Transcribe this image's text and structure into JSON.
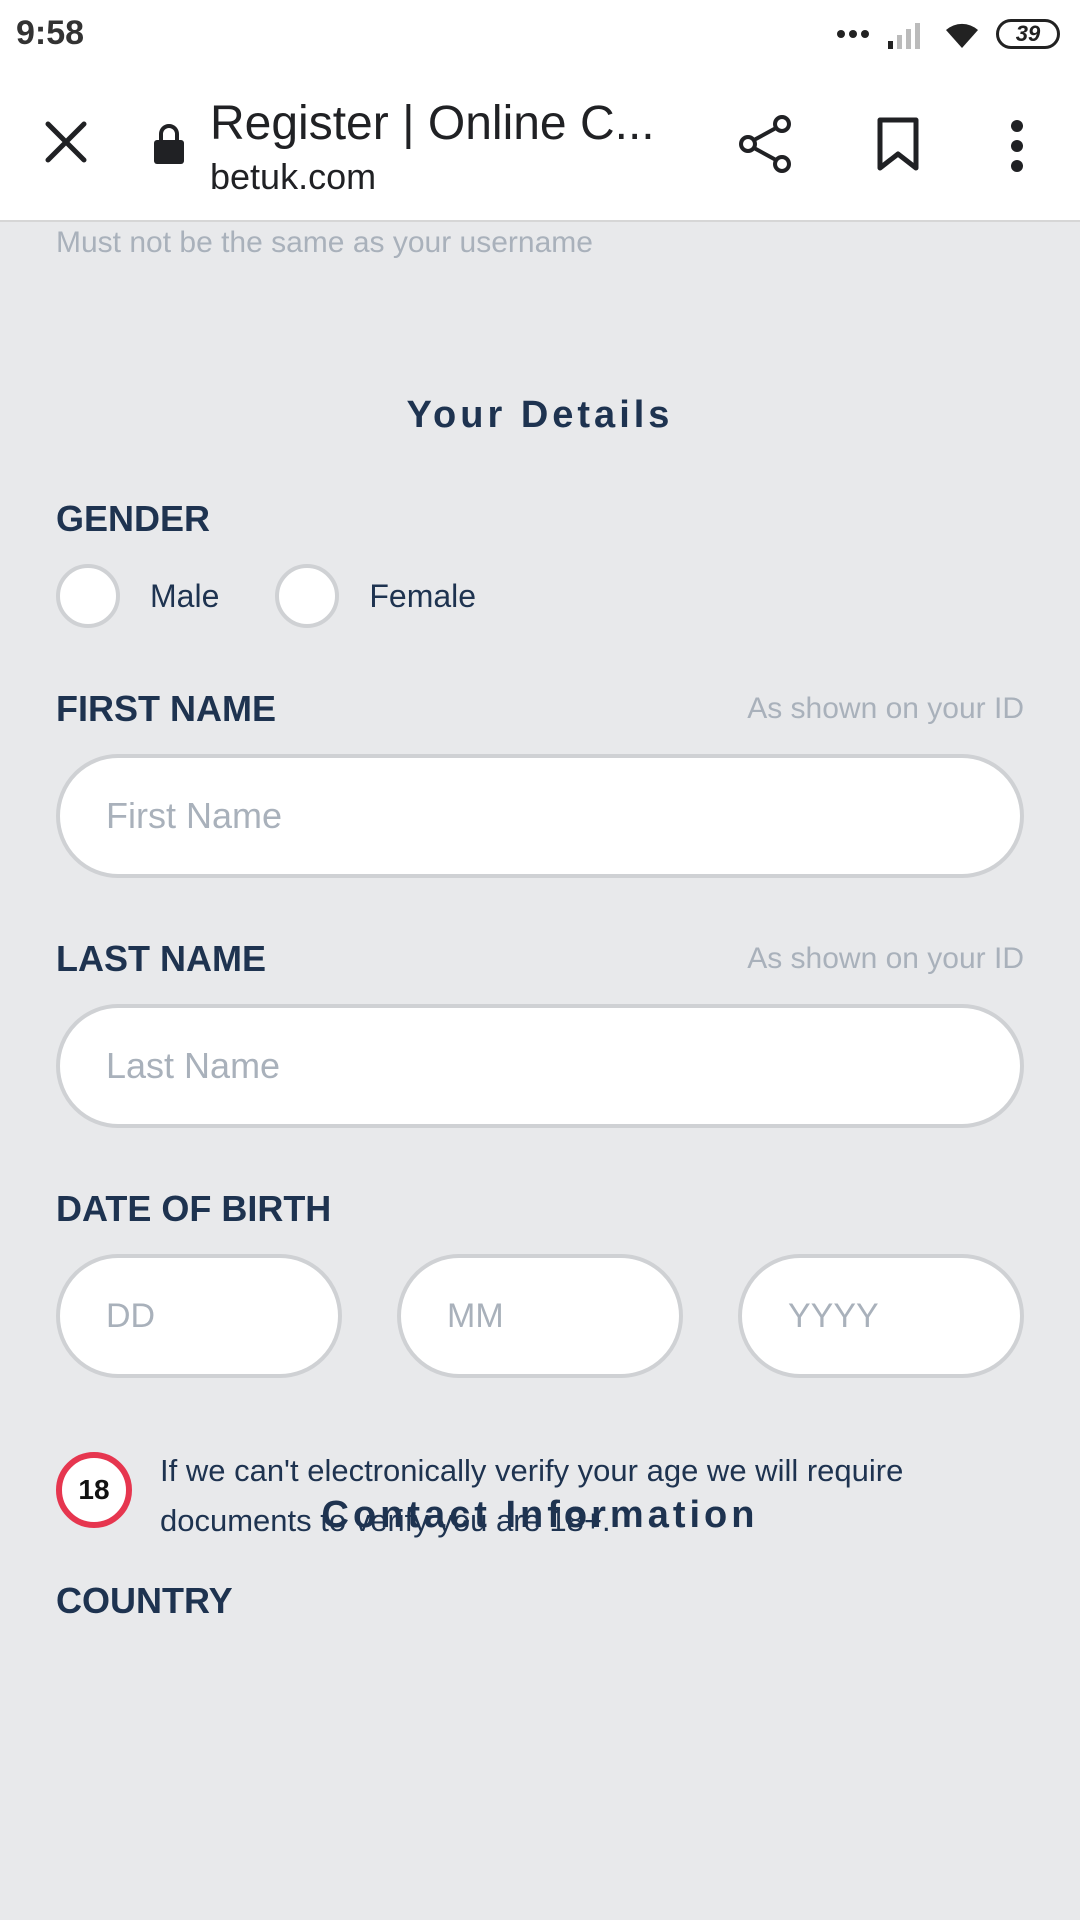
{
  "status_bar": {
    "time": "9:58",
    "battery": "39",
    "icons": [
      "signal-dots-icon",
      "signal-bars-icon",
      "wifi-icon",
      "battery-icon"
    ]
  },
  "browser": {
    "page_title": "Register | Online C...",
    "url": "betuk.com",
    "icons": [
      "close-icon",
      "lock-icon",
      "share-icon",
      "bookmark-icon",
      "more-vert-icon"
    ]
  },
  "form": {
    "password_hint": "Must not be the same as your username",
    "your_details_title": "Your Details",
    "gender": {
      "label": "GENDER",
      "options": [
        "Male",
        "Female"
      ]
    },
    "first_name": {
      "label": "FIRST NAME",
      "hint": "As shown on your ID",
      "placeholder": "First Name",
      "value": ""
    },
    "last_name": {
      "label": "LAST NAME",
      "hint": "As shown on your ID",
      "placeholder": "Last Name",
      "value": ""
    },
    "dob": {
      "label": "DATE OF BIRTH",
      "day_placeholder": "DD",
      "month_placeholder": "MM",
      "year_placeholder": "YYYY"
    },
    "age_notice": {
      "badge": "18",
      "text": "If we can't electronically verify your age we will require documents to verify you are 18+."
    },
    "contact_title": "Contact Information",
    "country_label": "COUNTRY"
  },
  "colors": {
    "background": "#e8e9eb",
    "label": "#1e3350",
    "hint": "#a9b1bb",
    "age_badge_ring": "#e6364f"
  }
}
